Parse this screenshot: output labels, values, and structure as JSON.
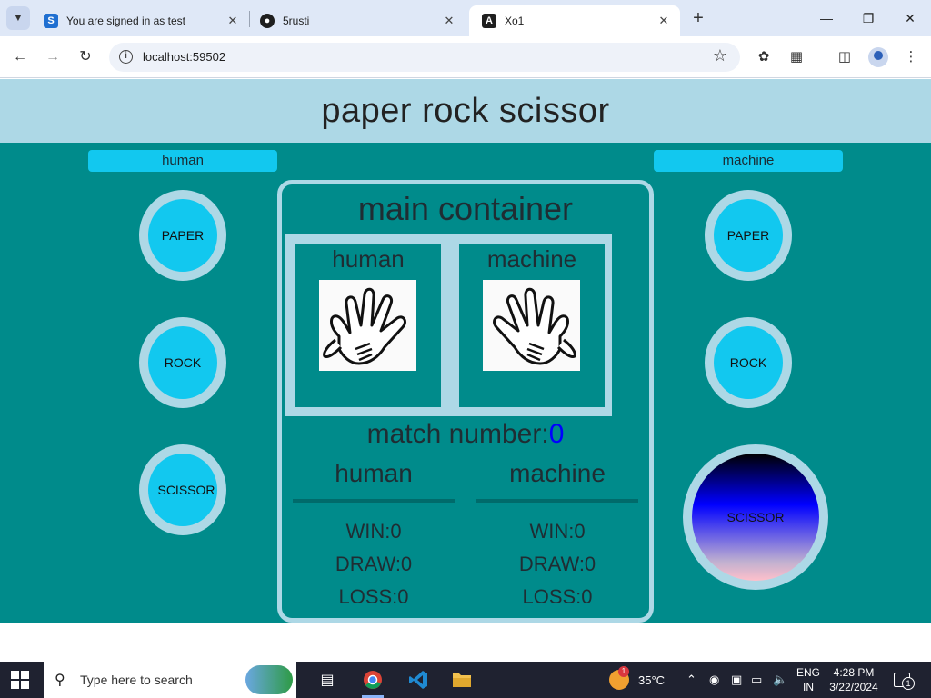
{
  "browser": {
    "tabs": [
      {
        "title": "You are signed in as test",
        "icon": "s-favicon-icon",
        "active": false
      },
      {
        "title": "5rusti",
        "icon": "github-icon",
        "active": false
      },
      {
        "title": "Xo1",
        "icon": "angular-icon",
        "active": true
      }
    ],
    "url": "localhost:59502"
  },
  "page": {
    "title": "paper rock scissor",
    "players": {
      "left": "human",
      "right": "machine"
    },
    "choices": [
      "PAPER",
      "ROCK",
      "SCISSOR"
    ],
    "main": {
      "title": "main container",
      "human_label": "human",
      "machine_label": "machine",
      "match_label": "match number:",
      "match_number": "0",
      "scores": {
        "human": {
          "name": "human",
          "win": "WIN:0",
          "draw": "DRAW:0",
          "loss": "LOSS:0"
        },
        "machine": {
          "name": "machine",
          "win": "WIN:0",
          "draw": "DRAW:0",
          "loss": "LOSS:0"
        }
      }
    }
  },
  "taskbar": {
    "search_placeholder": "Type here to search",
    "weather": "35°C",
    "weather_badge": "1",
    "lang_top": "ENG",
    "lang_bottom": "IN",
    "time": "4:28 PM",
    "date": "3/22/2024",
    "notification_count": "1"
  },
  "colors": {
    "header_bg": "#add8e6",
    "arena_bg": "#008b8b",
    "button": "#12c8ef",
    "match_number": "#0000ff"
  }
}
